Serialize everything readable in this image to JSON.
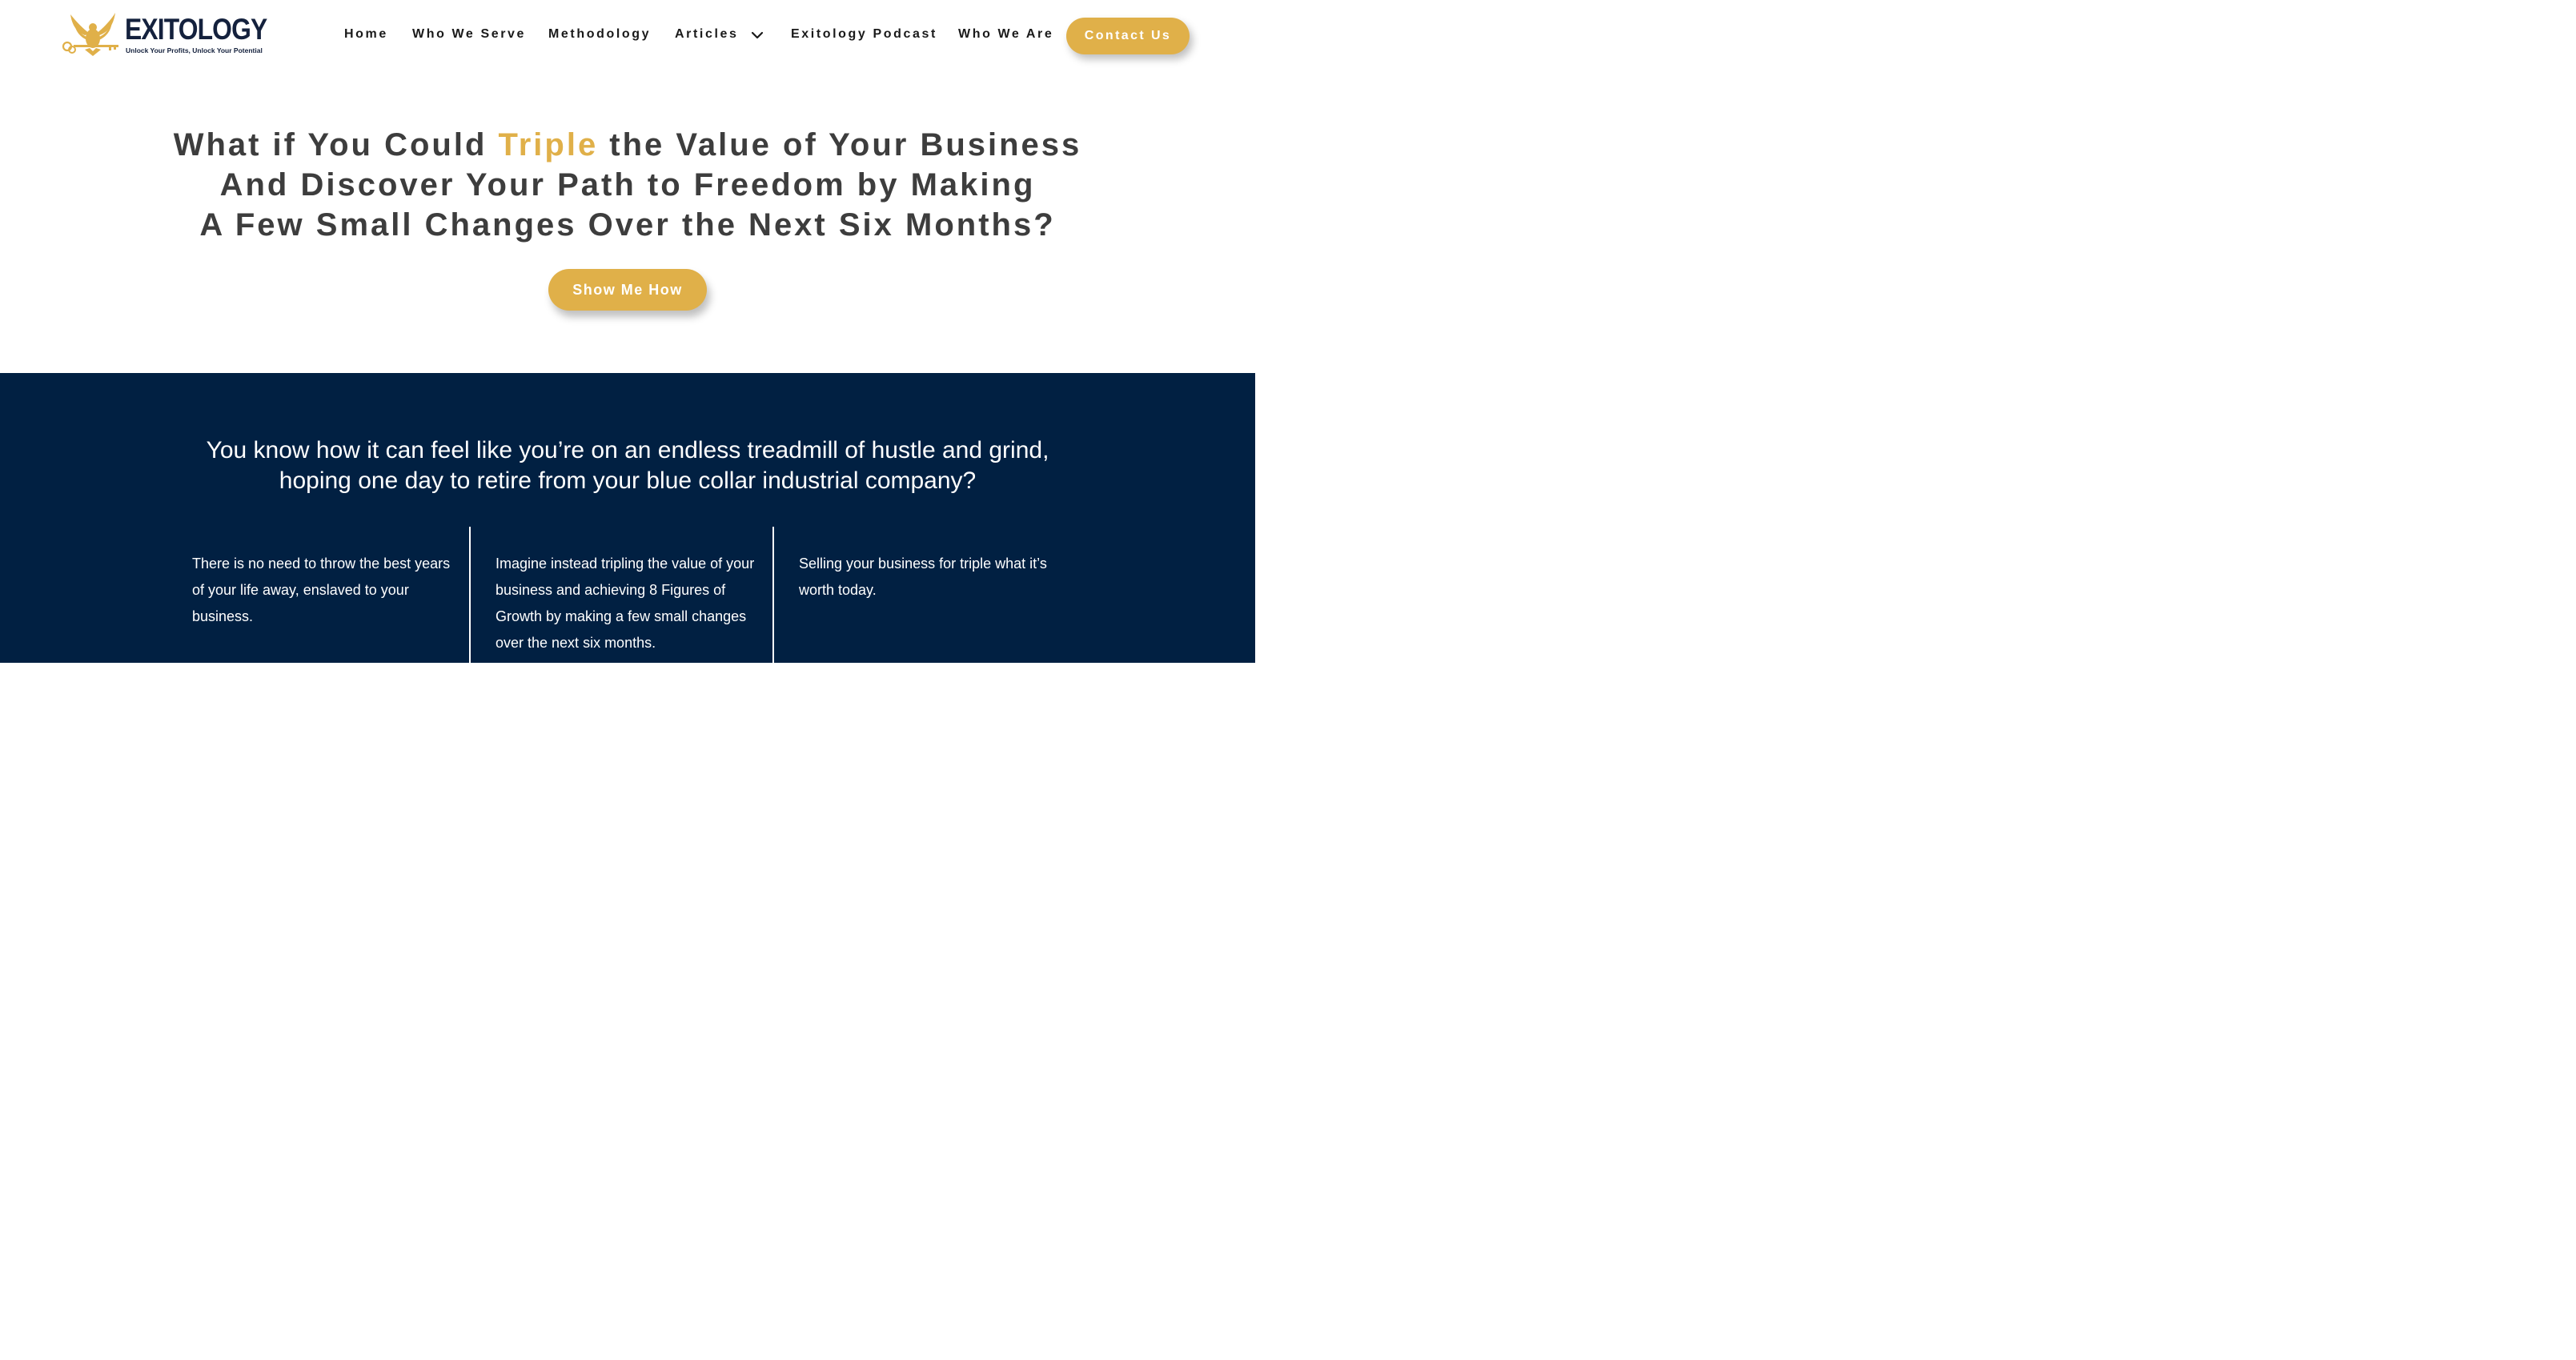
{
  "brand": {
    "name": "EXITOLOGY",
    "tagline": "Unlock Your Profits, Unlock Your Potential",
    "logo_icon": "eagle-key-icon",
    "colors": {
      "navy": "#012042",
      "gold": "#e0b049",
      "text": "#3d3d3d"
    }
  },
  "nav": {
    "items": [
      {
        "label": "Home"
      },
      {
        "label": "Who We Serve"
      },
      {
        "label": "Methodology"
      },
      {
        "label": "Articles",
        "icon": "chevron-down-icon"
      },
      {
        "label": "Exitology Podcast"
      },
      {
        "label": "Who We Are"
      }
    ],
    "contact_label": "Contact Us"
  },
  "hero": {
    "line1_pre": "What if You Could ",
    "line1_highlight": "Triple",
    "line1_post": " the Value of Your Business",
    "line2": "And Discover Your Path to Freedom by Making",
    "line3": "A Few Small Changes Over the Next Six Months?",
    "cta_label": "Show Me How"
  },
  "section": {
    "intro_line1": "You know how it can feel like you’re on an endless treadmill of hustle and grind,",
    "intro_line2": "hoping one day to retire from your blue collar industrial company?",
    "columns": [
      {
        "text": "There is no need to throw the best years of your life away, enslaved to your business."
      },
      {
        "text": "Imagine instead tripling the value of your business and achieving 8 Figures of Growth by making a few small changes over the next six months."
      },
      {
        "text": "Selling your business for triple what it’s worth today."
      }
    ]
  }
}
